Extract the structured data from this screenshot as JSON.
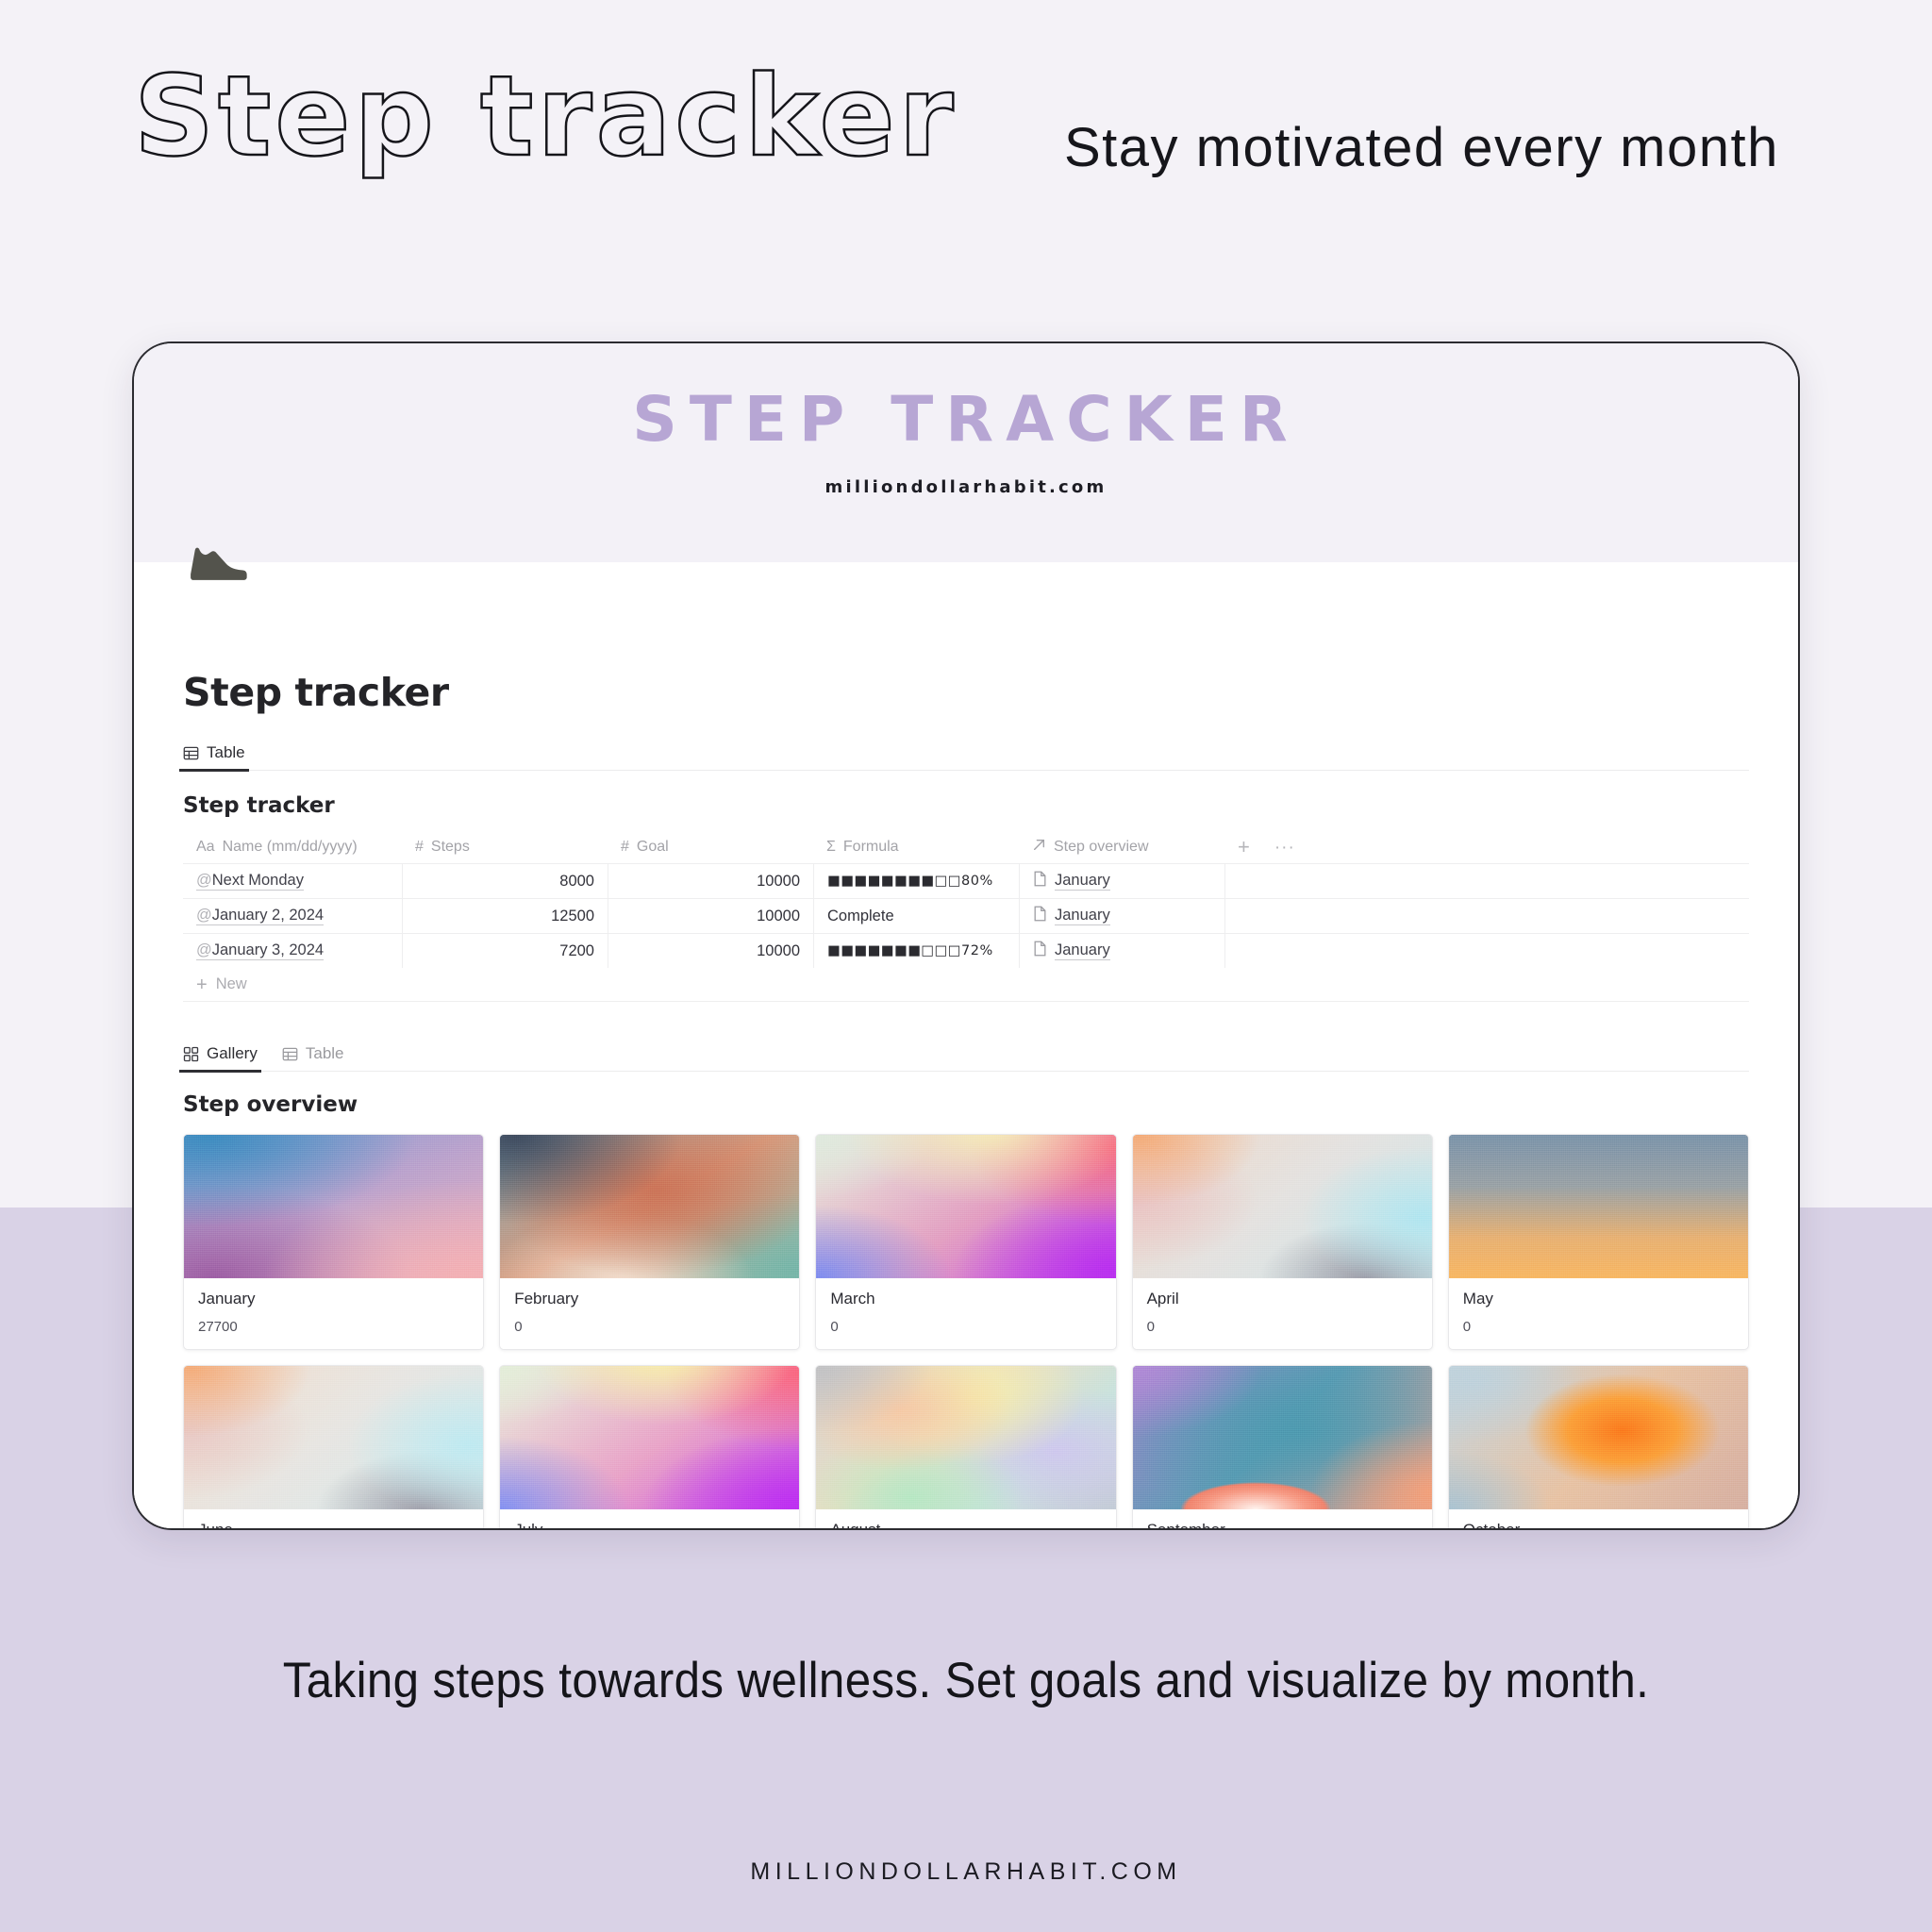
{
  "hero": {
    "title": "Step tracker",
    "subtitle": "Stay motivated every month"
  },
  "cover": {
    "title": "STEP TRACKER",
    "url": "milliondollarhabit.com",
    "icon": "sneaker-icon"
  },
  "page": {
    "title": "Step tracker"
  },
  "table_view": {
    "tabs": [
      {
        "label": "Table",
        "icon": "table-icon",
        "active": true
      }
    ],
    "db_title": "Step tracker",
    "columns": [
      {
        "label": "Name (mm/dd/yyyy)",
        "type_icon": "Aa"
      },
      {
        "label": "Steps",
        "type_icon": "#"
      },
      {
        "label": "Goal",
        "type_icon": "#"
      },
      {
        "label": "Formula",
        "type_icon": "Σ"
      },
      {
        "label": "Step overview",
        "type_icon": "relation-arrow-icon"
      }
    ],
    "add_column_label": "+",
    "more_label": "···",
    "rows": [
      {
        "name": "Next Monday",
        "name_prefix": "@",
        "steps": "8000",
        "goal": "10000",
        "formula_bar": "■■■■■■■■□□",
        "formula_pct": "80%",
        "formula_text": "",
        "step_overview": "January"
      },
      {
        "name": "January 2, 2024",
        "name_prefix": "@",
        "steps": "12500",
        "goal": "10000",
        "formula_bar": "",
        "formula_pct": "",
        "formula_text": "Complete",
        "step_overview": "January"
      },
      {
        "name": "January 3, 2024",
        "name_prefix": "@",
        "steps": "7200",
        "goal": "10000",
        "formula_bar": "■■■■■■■□□□",
        "formula_pct": "72%",
        "formula_text": "",
        "step_overview": "January"
      }
    ],
    "new_row_label": "New"
  },
  "gallery_view": {
    "tabs": [
      {
        "label": "Gallery",
        "icon": "gallery-icon",
        "active": true
      },
      {
        "label": "Table",
        "icon": "table-icon",
        "active": false
      }
    ],
    "title": "Step overview",
    "cards": [
      {
        "name": "January",
        "value": "27700",
        "grad": "grad-jan"
      },
      {
        "name": "February",
        "value": "0",
        "grad": "grad-feb"
      },
      {
        "name": "March",
        "value": "0",
        "grad": "grad-mar"
      },
      {
        "name": "April",
        "value": "0",
        "grad": "grad-apr"
      },
      {
        "name": "May",
        "value": "0",
        "grad": "grad-may"
      },
      {
        "name": "June",
        "value": "",
        "grad": "grad-jun"
      },
      {
        "name": "July",
        "value": "",
        "grad": "grad-jul"
      },
      {
        "name": "August",
        "value": "",
        "grad": "grad-aug"
      },
      {
        "name": "September",
        "value": "",
        "grad": "grad-sep"
      },
      {
        "name": "October",
        "value": "",
        "grad": "grad-oct"
      }
    ]
  },
  "tagline": "Taking steps towards wellness. Set goals and visualize by month.",
  "footer": "MILLIONDOLLARHABIT.COM",
  "colors": {
    "bg_top": "#f4f2f7",
    "bg_bottom": "#d9d2e6",
    "cover_title": "#b7a6d4",
    "text_dark": "#242428"
  }
}
